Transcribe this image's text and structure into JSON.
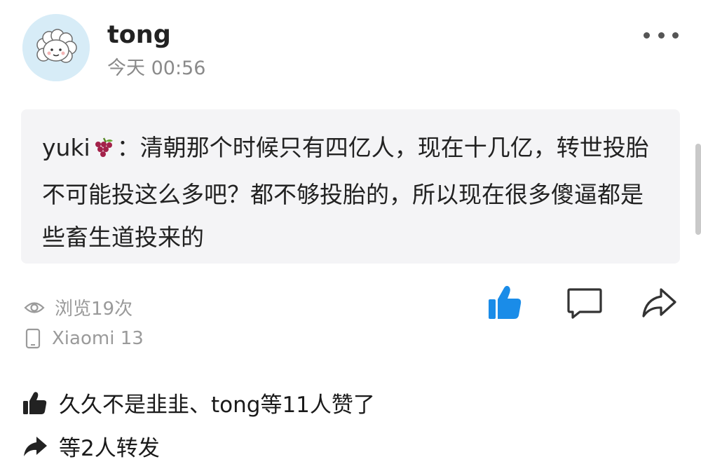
{
  "post": {
    "author": "tong",
    "time": "今天 00:56",
    "quote": {
      "user": "yuki",
      "user_emoji": "grape-icon",
      "separator": "：",
      "text": "清朝那个时候只有四亿人，现在十几亿，转世投胎不可能投这么多吧？都不够投胎的，所以现在很多傻逼都是些畜生道投来的"
    },
    "views": "浏览19次",
    "device": "Xiaomi 13",
    "likes_summary": "久久不是韭韭、tong等11人赞了",
    "reposts_summary": "等2人转发"
  },
  "icons": {
    "more": "more-dots-icon",
    "eye": "eye-icon",
    "phone": "phone-icon",
    "like": "thumbs-up-icon",
    "comment": "comment-icon",
    "share": "share-icon"
  },
  "colors": {
    "accent": "#1a8ce8",
    "quote_bg": "#f4f4f6",
    "muted_text": "#9a9a9a",
    "avatar_bg": "#d7ecf7"
  }
}
